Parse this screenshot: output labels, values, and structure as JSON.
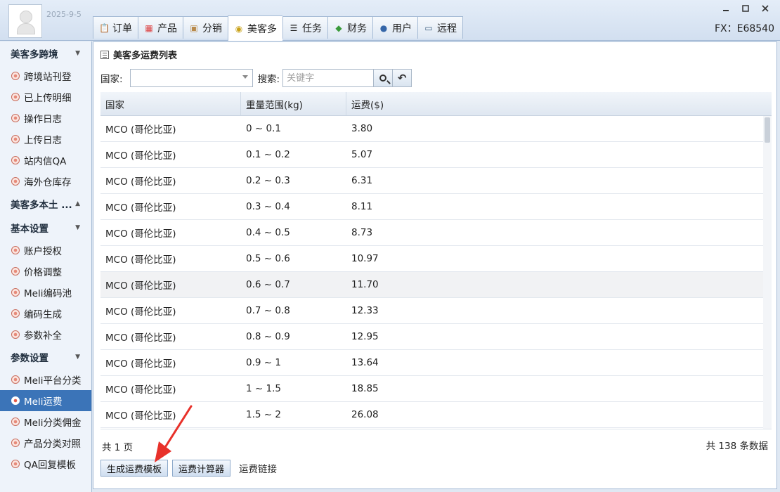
{
  "header": {
    "date": "2025-9-5",
    "code_label": "FX：E68540",
    "tabs": [
      {
        "label": "订单",
        "icon": "clipboard-icon"
      },
      {
        "label": "产品",
        "icon": "grid-icon"
      },
      {
        "label": "分销",
        "icon": "box-icon"
      },
      {
        "label": "美客多",
        "icon": "handshake-icon"
      },
      {
        "label": "任务",
        "icon": "task-list-icon"
      },
      {
        "label": "财务",
        "icon": "money-icon"
      },
      {
        "label": "用户",
        "icon": "user-icon"
      },
      {
        "label": "远程",
        "icon": "monitor-icon"
      }
    ]
  },
  "sidebar": {
    "sec1": {
      "title": "美客多跨境",
      "arrow": "▼"
    },
    "sec1_items": [
      "跨境站刊登",
      "已上传明细",
      "操作日志",
      "上传日志",
      "站内信QA",
      "海外仓库存"
    ],
    "sec2": {
      "title": "美客多本土 ...",
      "arrow": "▲"
    },
    "sec3": {
      "title": "基本设置",
      "arrow": "▼"
    },
    "sec3_items": [
      "账户授权",
      "价格调整",
      "Meli编码池",
      "编码生成",
      "参数补全"
    ],
    "sec4": {
      "title": "参数设置",
      "arrow": "▼"
    },
    "sec4_items": [
      "Meli平台分类",
      "Meli运费",
      "Meli分类佣金",
      "产品分类对照",
      "QA回复模板"
    ]
  },
  "main": {
    "title": "美客多运费列表",
    "country_label": "国家:",
    "search_label": "搜索:",
    "search_placeholder": "关键字",
    "columns": [
      "国家",
      "重量范围(kg)",
      "运费($)"
    ],
    "rows": [
      [
        "MCO (哥伦比亚)",
        "0 ~ 0.1",
        "3.80"
      ],
      [
        "MCO (哥伦比亚)",
        "0.1 ~ 0.2",
        "5.07"
      ],
      [
        "MCO (哥伦比亚)",
        "0.2 ~ 0.3",
        "6.31"
      ],
      [
        "MCO (哥伦比亚)",
        "0.3 ~ 0.4",
        "8.11"
      ],
      [
        "MCO (哥伦比亚)",
        "0.4 ~ 0.5",
        "8.73"
      ],
      [
        "MCO (哥伦比亚)",
        "0.5 ~ 0.6",
        "10.97"
      ],
      [
        "MCO (哥伦比亚)",
        "0.6 ~ 0.7",
        "11.70"
      ],
      [
        "MCO (哥伦比亚)",
        "0.7 ~ 0.8",
        "12.33"
      ],
      [
        "MCO (哥伦比亚)",
        "0.8 ~ 0.9",
        "12.95"
      ],
      [
        "MCO (哥伦比亚)",
        "0.9 ~ 1",
        "13.64"
      ],
      [
        "MCO (哥伦比亚)",
        "1 ~ 1.5",
        "18.85"
      ],
      [
        "MCO (哥伦比亚)",
        "1.5 ~ 2",
        "26.08"
      ]
    ],
    "pages_text": "共 1 页",
    "total_text": "共 138 条数据",
    "generate_button": "生成运费模板",
    "calculator_button": "运费计算器",
    "link_label": "运费链接"
  }
}
